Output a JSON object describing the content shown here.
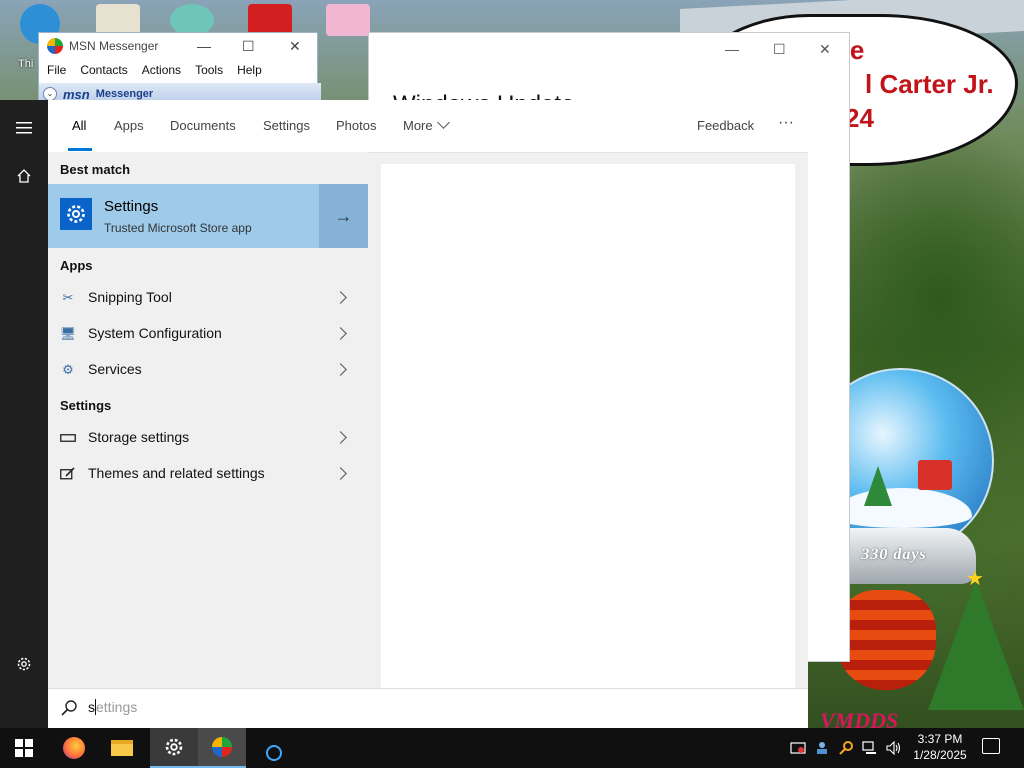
{
  "desktop": {
    "icon_label": "Thi",
    "bubble_lines": [
      "ace",
      "l Carter Jr.",
      "24"
    ],
    "globe_text": "330 days",
    "bottom_text": "VMDDS"
  },
  "background_window": {
    "title": "Windows Update"
  },
  "msn_messenger": {
    "title": "MSN Messenger",
    "menu": [
      "File",
      "Contacts",
      "Actions",
      "Tools",
      "Help"
    ],
    "banner_brand": "msn",
    "banner_product": "Messenger"
  },
  "search": {
    "tabs": [
      "All",
      "Apps",
      "Documents",
      "Settings",
      "Photos",
      "More"
    ],
    "active_tab": "All",
    "feedback_label": "Feedback",
    "more_options": "···",
    "best_match_heading": "Best match",
    "best_match": {
      "title": "Settings",
      "subtitle": "Trusted Microsoft Store app",
      "arrow": "→"
    },
    "apps_heading": "Apps",
    "apps": [
      {
        "label": "Snipping Tool",
        "icon": "snipping-tool-icon"
      },
      {
        "label": "System Configuration",
        "icon": "system-configuration-icon"
      },
      {
        "label": "Services",
        "icon": "services-icon"
      }
    ],
    "settings_heading": "Settings",
    "settings": [
      {
        "label": "Storage settings",
        "icon": "storage-icon"
      },
      {
        "label": "Themes and related settings",
        "icon": "themes-icon"
      }
    ],
    "query_typed": "s",
    "query_hint": "ettings"
  },
  "taskbar": {
    "apps": [
      "start-icon",
      "firefox-icon",
      "file-explorer-icon",
      "settings-icon",
      "msn-messenger-icon",
      "cortana-icon"
    ],
    "active_app": "settings-icon",
    "time": "3:37 PM",
    "date": "1/28/2025"
  },
  "colors": {
    "accent": "#0078d7",
    "best_match_bg": "#9fcbea",
    "rail_bg": "#1f1f1f",
    "taskbar_bg": "#101010"
  }
}
